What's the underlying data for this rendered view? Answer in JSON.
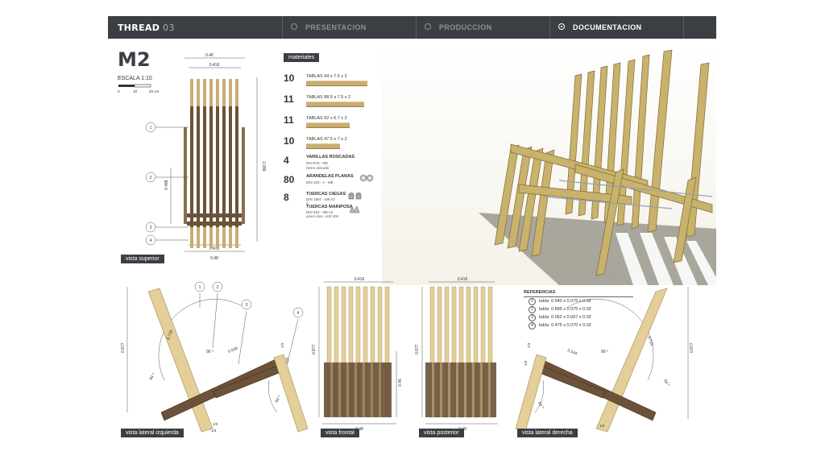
{
  "header": {
    "brand": "THREAD",
    "brand_num": "03",
    "tabs": [
      {
        "label": "PRESENTACION",
        "active": false
      },
      {
        "label": "PRODUCCION",
        "active": false
      },
      {
        "label": "DOCUMENTACION",
        "active": true
      }
    ]
  },
  "model": {
    "code": "M2",
    "scale_label": "ESCALA  1:10",
    "scale_ticks": [
      "0",
      "10",
      "20 cm"
    ]
  },
  "top_view": {
    "label": "vista superior",
    "dims": {
      "outer_top": "0.46",
      "inner_top": "0.416",
      "height": "1.089",
      "mid": "0.488",
      "inner_bottom": "0.416",
      "outer_bottom": "0.48"
    },
    "callouts": [
      "1",
      "2",
      "3",
      "4"
    ]
  },
  "materials": {
    "header": "materiales",
    "boards": [
      {
        "qty": "10",
        "text": "TABLAS  94 x 7.5 x 2"
      },
      {
        "qty": "11",
        "text": "TABLAS  88.5 x 7.5 x 2"
      },
      {
        "qty": "11",
        "text": "TABLAS  62 x 6.7 x 2"
      },
      {
        "qty": "10",
        "text": "TABLAS  47.5 x 7 x 2"
      }
    ],
    "hardware": [
      {
        "qty": "4",
        "title": "VARILLAS  ROSCADAS",
        "sub": [
          "DIN 975 - M8",
          "hierro zincado"
        ]
      },
      {
        "qty": "80",
        "title": "ARANDELAS  PLANAS",
        "sub": [
          "DIN 125 - A - M8"
        ]
      },
      {
        "qty": "8",
        "title": "TUERCAS CIEGAS",
        "sub": [
          "DIN 1587 - M8 A2",
          "ó"
        ]
      },
      {
        "qty": "",
        "title": "TUERCAS MARIPOSA",
        "sub": [
          "DIN 315 - M8 A2",
          "acero inox. AISI 304"
        ]
      }
    ]
  },
  "left_view": {
    "label": "vista lateral izquierda",
    "dims": {
      "height": "0.877",
      "seat": "0.545",
      "back": "0.716",
      "angle1": "90 º",
      "angle2": "64 º",
      "angle3": "64 º",
      "s1": "1/3",
      "s2": "1/3",
      "s3": "1/3",
      "s4": "1/3"
    },
    "callouts": [
      "1",
      "2",
      "3",
      "4"
    ]
  },
  "front_view": {
    "label": "vista frontal",
    "dims": {
      "top": "0.416",
      "height": "0.877",
      "seat_h": "0.46",
      "bottom": "0.48"
    }
  },
  "back_view": {
    "label": "vista posterior",
    "dims": {
      "top": "0.416",
      "height": "0.877",
      "bottom": "0.48"
    }
  },
  "right_view": {
    "label": "vista lateral derecha",
    "dims": {
      "height": "0.877",
      "seat": "0.544",
      "back": "0.715",
      "angle1": "90 º",
      "angle2": "64 º",
      "angle3": "64 º",
      "s1": "1/3",
      "s2": "1/3",
      "s3": "1/3"
    }
  },
  "references": {
    "title": "REFERENCIAS",
    "rows": [
      {
        "n": "1",
        "text": "tabla:  0.940  x  0.075  x  0.02"
      },
      {
        "n": "2",
        "text": "tabla:  0.885  x  0.075  x  0.02"
      },
      {
        "n": "3",
        "text": "tabla:  0.062  x  0.067  x  0.02"
      },
      {
        "n": "4",
        "text": "tabla:  0.475  x  0.070  x  0.02"
      }
    ]
  },
  "colors": {
    "header_bg": "#3b3f44",
    "wood_light": "#c9ad72",
    "wood_dark": "#6b5238"
  }
}
